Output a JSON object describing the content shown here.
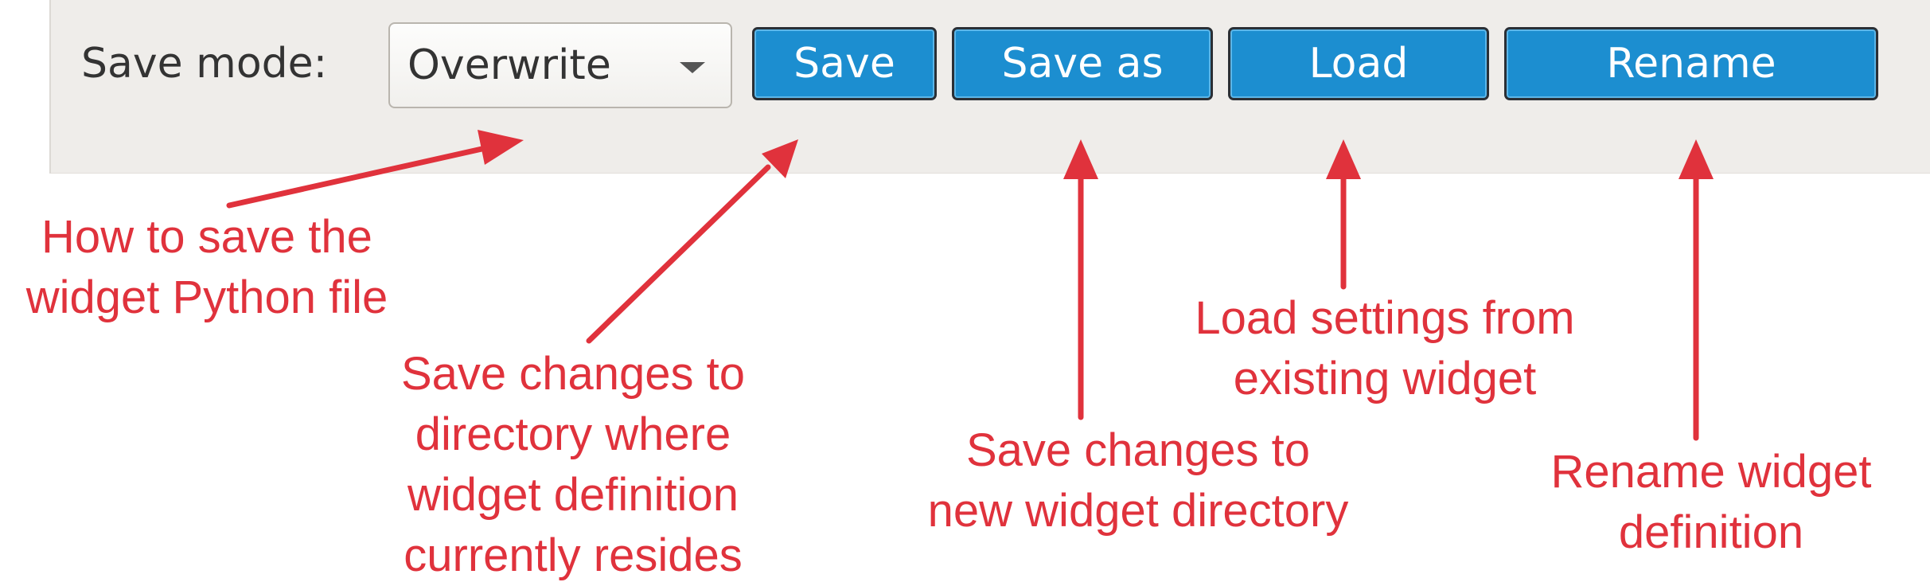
{
  "toolbar": {
    "save_mode_label": "Save mode:",
    "save_mode_value": "Overwrite",
    "buttons": {
      "save": "Save",
      "save_as": "Save as",
      "load": "Load",
      "rename": "Rename"
    }
  },
  "annotations": {
    "save_mode": "How to save the\nwidget Python file",
    "save": "Save changes to\ndirectory where\nwidget definition\ncurrently resides",
    "save_as": "Save changes to\nnew widget directory",
    "load": "Load settings from\nexisting widget",
    "rename": "Rename widget\ndefinition"
  },
  "colors": {
    "annotation": "#e0323c",
    "button": "#1c8ed0",
    "panel": "#efedea"
  }
}
